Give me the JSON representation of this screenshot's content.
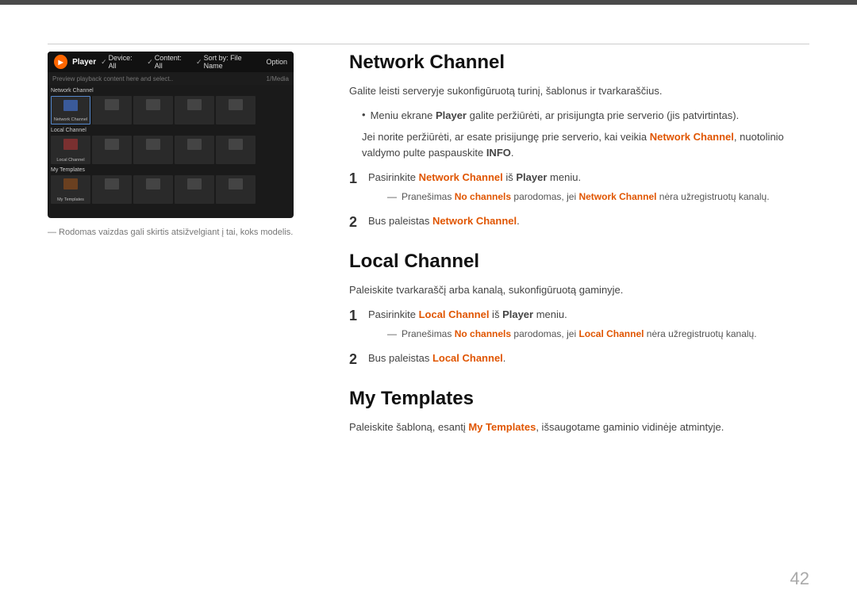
{
  "topBar": {},
  "leftPanel": {
    "caption": "― Rodomas vaizdas gali skirtis atsižvelgiant į tai, koks modelis."
  },
  "player": {
    "label": "Player",
    "controls": [
      "Device: All",
      "Content: All",
      "Sort by: File Name",
      "Option"
    ],
    "searchPlaceholder": "Preview playback content here and select..",
    "count": "1/Media",
    "sections": [
      {
        "title": "Network Channel",
        "items": [
          "network",
          "dark",
          "dark",
          "dark",
          "dark"
        ]
      },
      {
        "title": "Local Channel",
        "items": [
          "local",
          "dark",
          "dark",
          "dark",
          "dark"
        ]
      },
      {
        "title": "My Templates",
        "items": [
          "mytemp",
          "dark",
          "dark",
          "dark",
          "dark"
        ]
      }
    ]
  },
  "networkChannel": {
    "heading": "Network Channel",
    "intro": "Galite leisti serveryje sukonfigūruotą turinį, šablonus ir tvarkaraščius.",
    "bullet1": "Meniu ekrane ",
    "bullet1_bold": "Player",
    "bullet1_rest": " galite peržiūrėti, ar prisijungta prie serverio (jis patvirtintas).",
    "info_pre": "Jei norite peržiūrėti, ar esate prisijungę prie serverio, kai veikia ",
    "info_orange": "Network Channel",
    "info_post": ", nuotolinio valdymo pulte paspauskite ",
    "info_bold": "INFO",
    "info_end": ".",
    "step1_num": "1",
    "step1_pre": "Pasirinkite ",
    "step1_orange": "Network Channel",
    "step1_mid": " iš ",
    "step1_bold": "Player",
    "step1_end": " meniu.",
    "sub1_dash": "—",
    "sub1_pre": "Pranešimas ",
    "sub1_orange": "No channels",
    "sub1_mid": " parodomas, jei ",
    "sub1_orange2": "Network Channel",
    "sub1_end": " nėra užregistruotų kanalų.",
    "step2_num": "2",
    "step2_pre": "Bus paleistas ",
    "step2_orange": "Network Channel",
    "step2_end": "."
  },
  "localChannel": {
    "heading": "Local Channel",
    "intro": "Paleiskite tvarkaraščį arba kanalą, sukonfigūruotą gaminyje.",
    "step1_num": "1",
    "step1_pre": "Pasirinkite ",
    "step1_orange": "Local Channel",
    "step1_mid": " iš ",
    "step1_bold": "Player",
    "step1_end": " meniu.",
    "sub1_dash": "—",
    "sub1_pre": "Pranešimas ",
    "sub1_orange": "No channels",
    "sub1_mid": " parodomas, jei ",
    "sub1_orange2": "Local Channel",
    "sub1_end": " nėra užregistruotų kanalų.",
    "step2_num": "2",
    "step2_pre": "Bus paleistas ",
    "step2_orange": "Local Channel",
    "step2_end": "."
  },
  "myTemplates": {
    "heading": "My Templates",
    "intro_pre": "Paleiskite šabloną, esantį ",
    "intro_orange": "My Templates",
    "intro_end": ", išsaugotame gaminio vidinėje atmintyje."
  },
  "pageNumber": "42"
}
